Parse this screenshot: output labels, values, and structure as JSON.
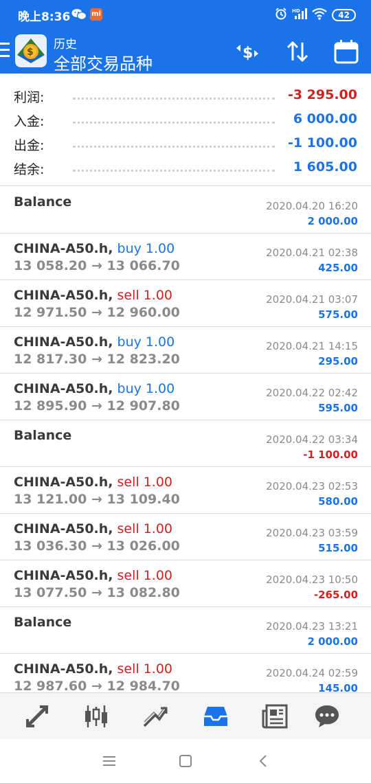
{
  "status_bar": {
    "time": "晚上8:36",
    "mi_badge": "mi",
    "battery": "42",
    "network_label": "HD"
  },
  "toolbar": {
    "subtitle": "历史",
    "title": "全部交易品种",
    "icons": [
      "menu-icon",
      "app-logo-icon",
      "currency-swap-icon",
      "sort-icon",
      "calendar-icon"
    ]
  },
  "summary": [
    {
      "label": "利润:",
      "value": "-3 295.00",
      "color": "#d32020"
    },
    {
      "label": "入金:",
      "value": "6 000.00",
      "color": "#1a73e8"
    },
    {
      "label": "出金:",
      "value": "-1 100.00",
      "color": "#1a73e8"
    },
    {
      "label": "结余:",
      "value": "1 605.00",
      "color": "#1a73e8"
    }
  ],
  "deals": [
    {
      "kind": "balance",
      "title": "Balance",
      "time": "2020.04.20 16:20",
      "amount": "2 000.00",
      "amount_color": "blue"
    },
    {
      "kind": "trade",
      "symbol": "CHINA-A50.h,",
      "side": "buy 1.00",
      "side_color": "blue",
      "prices": "13 058.20 → 13 066.70",
      "time": "2020.04.21 02:38",
      "amount": "425.00",
      "amount_color": "blue"
    },
    {
      "kind": "trade",
      "symbol": "CHINA-A50.h,",
      "side": "sell 1.00",
      "side_color": "red",
      "prices": "12 971.50 → 12 960.00",
      "time": "2020.04.21 03:07",
      "amount": "575.00",
      "amount_color": "blue"
    },
    {
      "kind": "trade",
      "symbol": "CHINA-A50.h,",
      "side": "buy 1.00",
      "side_color": "blue",
      "prices": "12 817.30 → 12 823.20",
      "time": "2020.04.21 14:15",
      "amount": "295.00",
      "amount_color": "blue"
    },
    {
      "kind": "trade",
      "symbol": "CHINA-A50.h,",
      "side": "buy 1.00",
      "side_color": "blue",
      "prices": "12 895.90 → 12 907.80",
      "time": "2020.04.22 02:42",
      "amount": "595.00",
      "amount_color": "blue"
    },
    {
      "kind": "balance",
      "title": "Balance",
      "time": "2020.04.22 03:34",
      "amount": "-1 100.00",
      "amount_color": "red"
    },
    {
      "kind": "trade",
      "symbol": "CHINA-A50.h,",
      "side": "sell 1.00",
      "side_color": "red",
      "prices": "13 121.00 → 13 109.40",
      "time": "2020.04.23 02:53",
      "amount": "580.00",
      "amount_color": "blue"
    },
    {
      "kind": "trade",
      "symbol": "CHINA-A50.h,",
      "side": "sell 1.00",
      "side_color": "red",
      "prices": "13 036.30 → 13 026.00",
      "time": "2020.04.23 03:59",
      "amount": "515.00",
      "amount_color": "blue"
    },
    {
      "kind": "trade",
      "symbol": "CHINA-A50.h,",
      "side": "sell 1.00",
      "side_color": "red",
      "prices": "13 077.50 → 13 082.80",
      "time": "2020.04.23 10:50",
      "amount": "-265.00",
      "amount_color": "red"
    },
    {
      "kind": "balance",
      "title": "Balance",
      "time": "2020.04.23 13:21",
      "amount": "2 000.00",
      "amount_color": "blue"
    },
    {
      "kind": "trade",
      "symbol": "CHINA-A50.h,",
      "side": "sell 1.00",
      "side_color": "red",
      "prices": "12 987.60 → 12 984.70",
      "time": "2020.04.24 02:59",
      "amount": "145.00",
      "amount_color": "blue"
    }
  ],
  "bottom_nav": [
    {
      "name": "quotes-icon",
      "active": false
    },
    {
      "name": "chart-candles-icon",
      "active": false
    },
    {
      "name": "trade-icon",
      "active": false
    },
    {
      "name": "history-inbox-icon",
      "active": true
    },
    {
      "name": "news-icon",
      "active": false
    },
    {
      "name": "chat-icon",
      "active": false
    }
  ],
  "colors": {
    "accent": "#1a73e8",
    "negative": "#d32020",
    "muted": "#8a8a8a",
    "nav_inactive": "#555555"
  }
}
